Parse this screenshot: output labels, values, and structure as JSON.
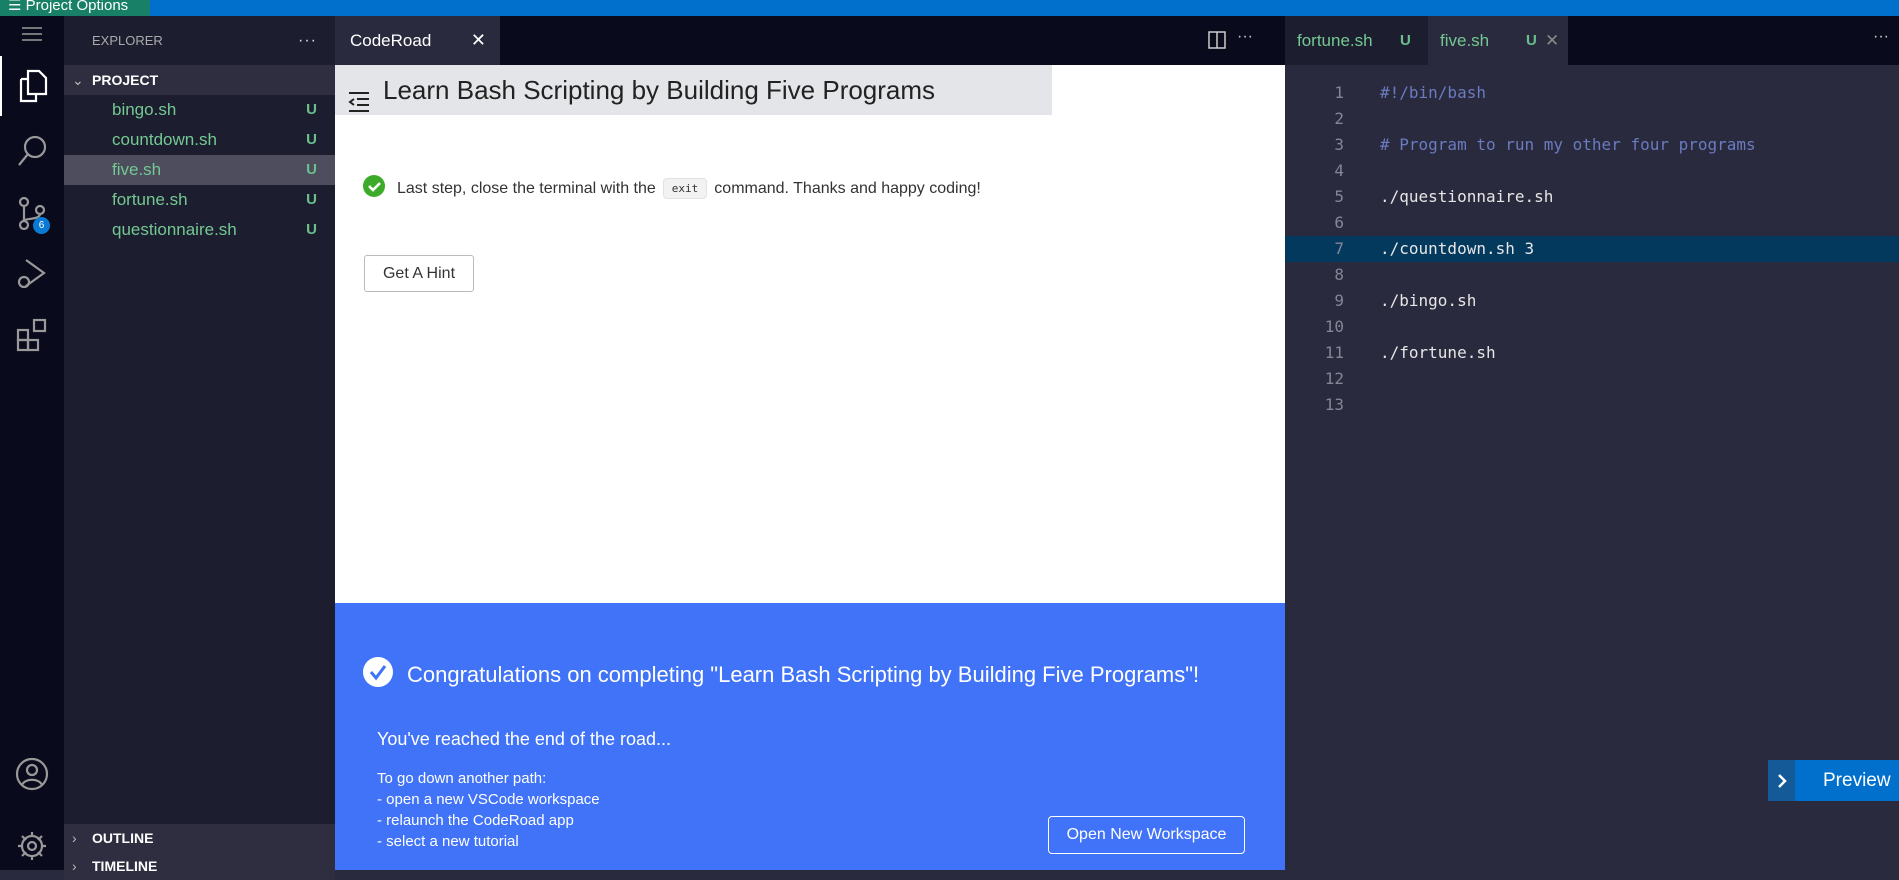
{
  "topbar": {
    "menu_label": "Project Options"
  },
  "activity": {
    "scm_badge": "6"
  },
  "explorer": {
    "title": "EXPLORER",
    "more": "···",
    "section": "PROJECT",
    "files": [
      {
        "name": "bingo.sh",
        "status": "U"
      },
      {
        "name": "countdown.sh",
        "status": "U"
      },
      {
        "name": "five.sh",
        "status": "U"
      },
      {
        "name": "fortune.sh",
        "status": "U"
      },
      {
        "name": "questionnaire.sh",
        "status": "U"
      }
    ],
    "outline": "OUTLINE",
    "timeline": "TIMELINE"
  },
  "coderoad": {
    "tab": "CodeRoad",
    "close": "✕",
    "title": "Learn Bash Scripting by Building Five Programs",
    "step": {
      "before": "Last step, close the terminal with the",
      "code": "exit",
      "after": "command. Thanks and happy coding!"
    },
    "hint_button": "Get A Hint",
    "done": {
      "heading": "Congratulations on completing \"Learn Bash Scripting by Building Five Programs\"!",
      "subheading": "You've reached the end of the road...",
      "intro": "To go down another path:",
      "options": [
        "- open a new VSCode workspace",
        "- relaunch the CodeRoad app",
        "- select a new tutorial"
      ],
      "button": "Open New Workspace"
    }
  },
  "editor": {
    "tabs": [
      {
        "name": "fortune.sh",
        "status": "U"
      },
      {
        "name": "five.sh",
        "status": "U",
        "close": "✕"
      }
    ],
    "more": "···",
    "lines": [
      {
        "n": "1",
        "t": "#!/bin/bash"
      },
      {
        "n": "2",
        "t": ""
      },
      {
        "n": "3",
        "t": "# Program to run my other four programs"
      },
      {
        "n": "4",
        "t": ""
      },
      {
        "n": "5",
        "t": "./questionnaire.sh"
      },
      {
        "n": "6",
        "t": ""
      },
      {
        "n": "7",
        "t": "./countdown.sh 3"
      },
      {
        "n": "8",
        "t": ""
      },
      {
        "n": "9",
        "t": "./bingo.sh"
      },
      {
        "n": "10",
        "t": ""
      },
      {
        "n": "11",
        "t": "./fortune.sh"
      },
      {
        "n": "12",
        "t": ""
      },
      {
        "n": "13",
        "t": ""
      }
    ]
  },
  "preview": {
    "label": "Preview"
  }
}
